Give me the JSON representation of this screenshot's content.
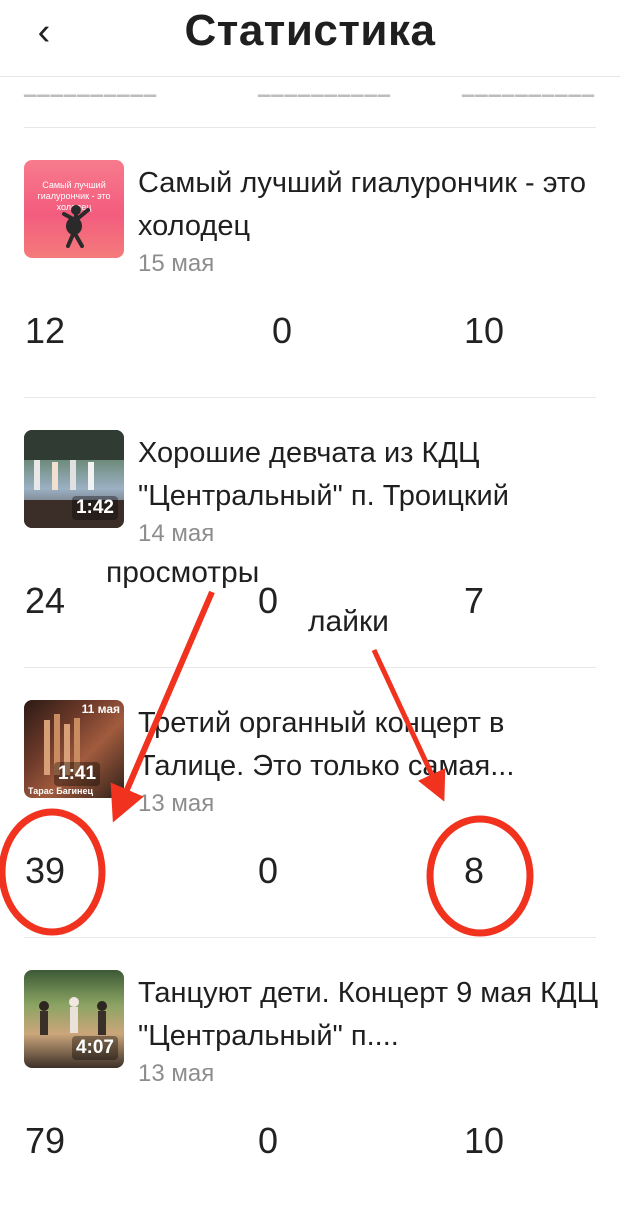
{
  "header": {
    "back_icon": "chevron-left-icon",
    "back_glyph": "‹",
    "title": "Статистика"
  },
  "posts": [
    {
      "title": "Самый лучший гиалурончик - это холодец",
      "date": "15 мая",
      "duration": "",
      "thumb_text": "Самый лучший гиалурончик - это холодец",
      "stats": {
        "views": "12",
        "comments": "0",
        "likes": "10"
      }
    },
    {
      "title": "Хорошие девчата из КДЦ \"Центральный\" п. Троицкий",
      "date": "14 мая",
      "duration": "1:42",
      "stats": {
        "views": "24",
        "comments": "0",
        "likes": "7"
      }
    },
    {
      "title": "Третий органный концерт в Талице. Это только самая...",
      "date": "13 мая",
      "duration": "1:41",
      "thumb_text": "11 мая",
      "thumb_caption": "Тарас Багинец",
      "stats": {
        "views": "39",
        "comments": "0",
        "likes": "8"
      }
    },
    {
      "title": "Танцуют дети. Концерт 9 мая КДЦ \"Центральный\" п....",
      "date": "13 мая",
      "duration": "4:07",
      "stats": {
        "views": "79",
        "comments": "0",
        "likes": "10"
      }
    }
  ],
  "annotations": {
    "views_label": "просмотры",
    "likes_label": "лайки",
    "color": "#f0321e"
  }
}
